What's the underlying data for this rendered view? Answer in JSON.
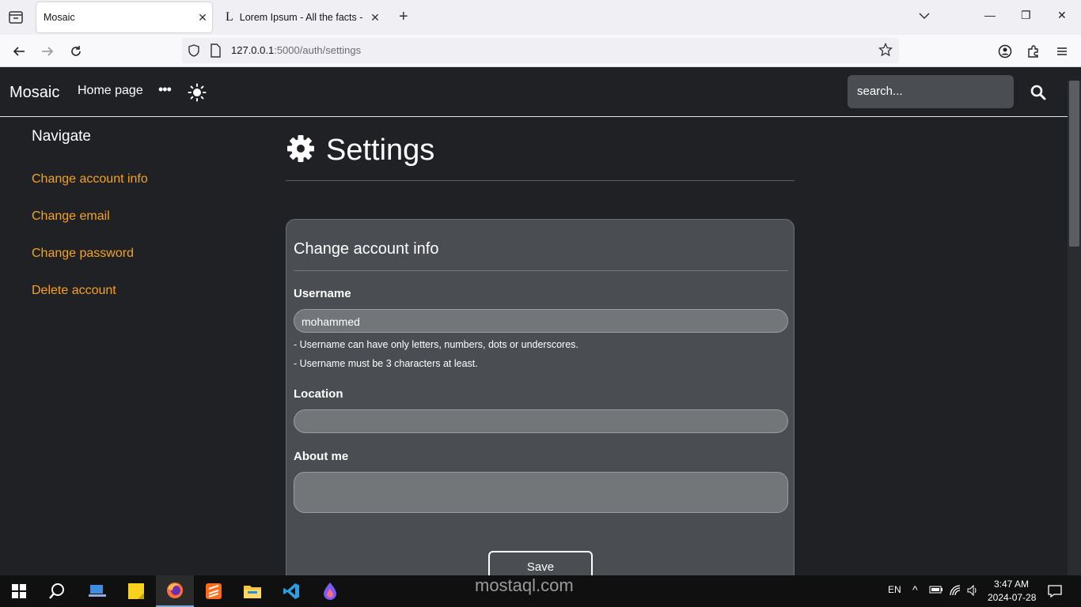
{
  "browser": {
    "tabs": [
      {
        "title": "Mosaic",
        "active": true
      },
      {
        "title": "Lorem Ipsum - All the facts - Lip",
        "active": false
      }
    ],
    "url_host": "127.0.0.1",
    "url_path": ":5000/auth/settings"
  },
  "site": {
    "brand": "Mosaic",
    "home_link": "Home page",
    "more": "•••",
    "search_placeholder": "search..."
  },
  "sidebar": {
    "title": "Navigate",
    "items": [
      {
        "label": "Change account info"
      },
      {
        "label": "Change email"
      },
      {
        "label": "Change password"
      },
      {
        "label": "Delete account"
      }
    ]
  },
  "main": {
    "title": "Settings",
    "card_title": "Change account info",
    "username_label": "Username",
    "username_value": "mohammed",
    "hint1": "- Username can have only letters, numbers, dots or underscores.",
    "hint2": "- Username must be 3 characters at least.",
    "location_label": "Location",
    "location_value": "",
    "about_label": "About me",
    "about_value": "",
    "save_label": "Save"
  },
  "watermark": "mostaql.com",
  "taskbar": {
    "lang": "EN",
    "time": "3:47 AM",
    "date": "2024-07-28"
  },
  "colors": {
    "accent": "#f6a21c",
    "page_bg": "#1f2125",
    "card_bg": "#4a4d52"
  }
}
